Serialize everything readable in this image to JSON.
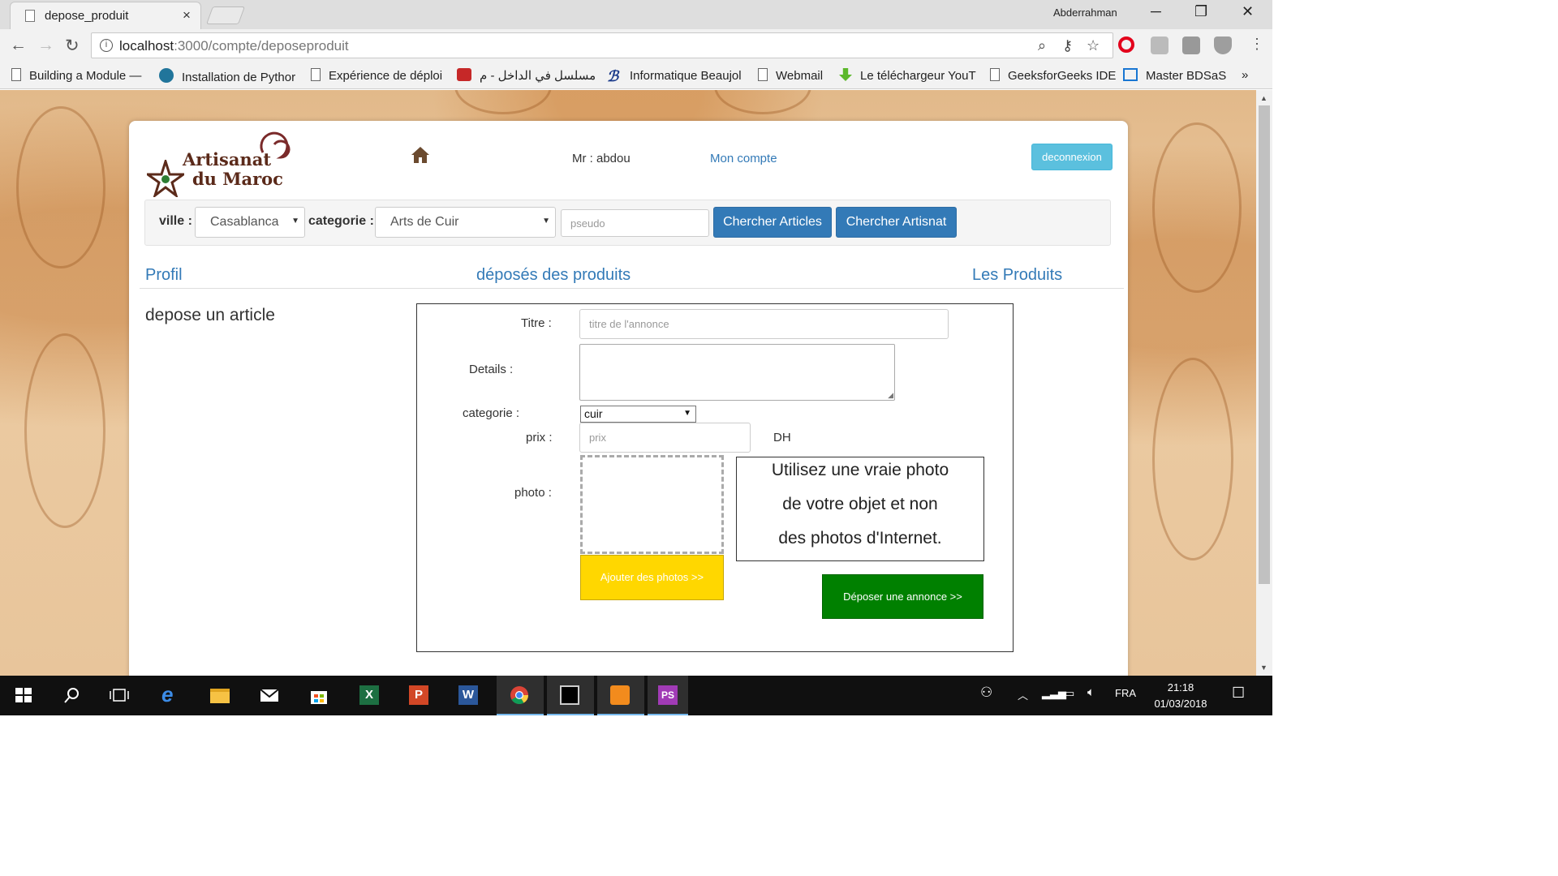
{
  "browser": {
    "tab_title": "depose_produit",
    "tab_close": "×",
    "profile_name": "Abderrahman",
    "window_buttons": [
      "─",
      "❐",
      "✕"
    ],
    "url_host": "localhost",
    "url_path": ":3000/compte/deposeproduit",
    "bookmarks": [
      {
        "label": "Building a Module —",
        "icon": "doc-icon"
      },
      {
        "label": "Installation de Pythor",
        "icon": "wordpress-icon"
      },
      {
        "label": "Expérience de déploi",
        "icon": "doc-icon"
      },
      {
        "label": "مسلسل في الداخل - م",
        "icon": "heart-icon"
      },
      {
        "label": "Informatique Beaujol",
        "icon": "b-logo-icon"
      },
      {
        "label": "Webmail",
        "icon": "doc-icon"
      },
      {
        "label": "Le téléchargeur YouT",
        "icon": "download-arrow-icon"
      },
      {
        "label": "GeeksforGeeks IDE",
        "icon": "doc-icon"
      },
      {
        "label": "Master BDSaS",
        "icon": "calendar-icon"
      }
    ],
    "bookmarks_overflow": "»"
  },
  "header": {
    "logo_line1": "Artisanat",
    "logo_line2": "du Maroc",
    "greeting": "Mr : abdou",
    "account_link": "Mon compte",
    "logout_label": "deconnexion"
  },
  "search": {
    "city_label": "ville :",
    "city_value": "Casablanca",
    "category_label": "categorie :",
    "category_value": "Arts de Cuir",
    "pseudo_placeholder": "pseudo",
    "search_articles_label": "Chercher Articles",
    "search_artisan_label": "Chercher Artisnat"
  },
  "nav": {
    "profile": "Profil",
    "deposited": "déposés des produits",
    "products": "Les Produits"
  },
  "side_title": "depose un article",
  "form": {
    "title_label": "Titre :",
    "title_placeholder": "titre de l'annonce",
    "details_label": "Details :",
    "category_label": "categorie :",
    "category_value": "cuir",
    "price_label": "prix :",
    "price_placeholder": "prix",
    "currency": "DH",
    "photo_label": "photo :",
    "add_photos_label": "Ajouter des photos >>",
    "tip_lines": [
      "Utilisez une vraie photo",
      "de votre objet et non",
      "des photos d'Internet."
    ],
    "submit_label": "Déposer une annonce >>"
  },
  "taskbar": {
    "language": "FRA",
    "time": "21:18",
    "date": "01/03/2018"
  },
  "colors": {
    "link_blue": "#337ab7",
    "info_button": "#5bc0de",
    "add_photo_yellow": "#ffd700",
    "submit_green": "#008000"
  }
}
